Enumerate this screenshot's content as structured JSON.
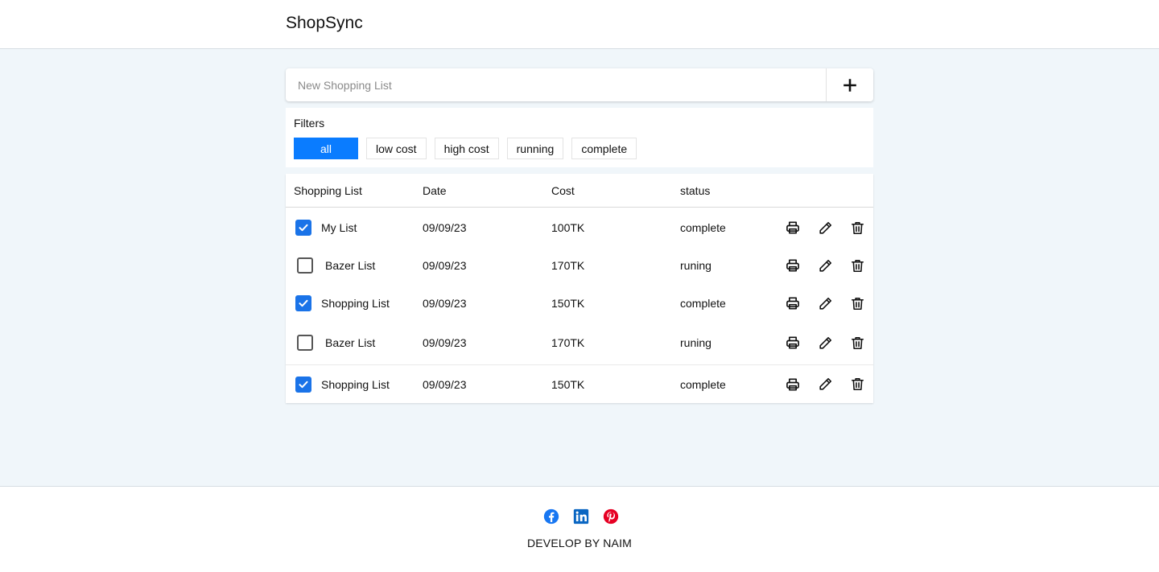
{
  "app": {
    "title": "ShopSync"
  },
  "new_list": {
    "placeholder": "New Shopping List",
    "value": "",
    "add_icon": "plus-icon"
  },
  "filters": {
    "title": "Filters",
    "options": [
      "all",
      "low cost",
      "high cost",
      "running",
      "complete"
    ],
    "active": "all",
    "active_color": "#0a7cff"
  },
  "table": {
    "headers": [
      "Shopping List",
      "Date",
      "Cost",
      "status"
    ],
    "rows": [
      {
        "checked": true,
        "name": "My List",
        "date": "09/09/23",
        "cost": "100TK",
        "status": "complete"
      },
      {
        "checked": false,
        "name": "Bazer List",
        "date": "09/09/23",
        "cost": "170TK",
        "status": "runing"
      },
      {
        "checked": true,
        "name": "Shopping List",
        "date": "09/09/23",
        "cost": "150TK",
        "status": "complete"
      },
      {
        "checked": false,
        "name": "Bazer List",
        "date": "09/09/23",
        "cost": "170TK",
        "status": "runing"
      },
      {
        "checked": true,
        "name": "Shopping List",
        "date": "09/09/23",
        "cost": "150TK",
        "status": "complete"
      }
    ],
    "row_actions": [
      "printer-icon",
      "pencil-icon",
      "trash-icon"
    ],
    "checkbox_color": "#1a73e8"
  },
  "footer": {
    "socials": [
      {
        "name": "facebook-icon",
        "color": "#1877f2"
      },
      {
        "name": "linkedin-icon",
        "color": "#0a66c2"
      },
      {
        "name": "pinterest-icon",
        "color": "#e60023"
      }
    ],
    "credit": "DEVELOP BY NAIM"
  }
}
